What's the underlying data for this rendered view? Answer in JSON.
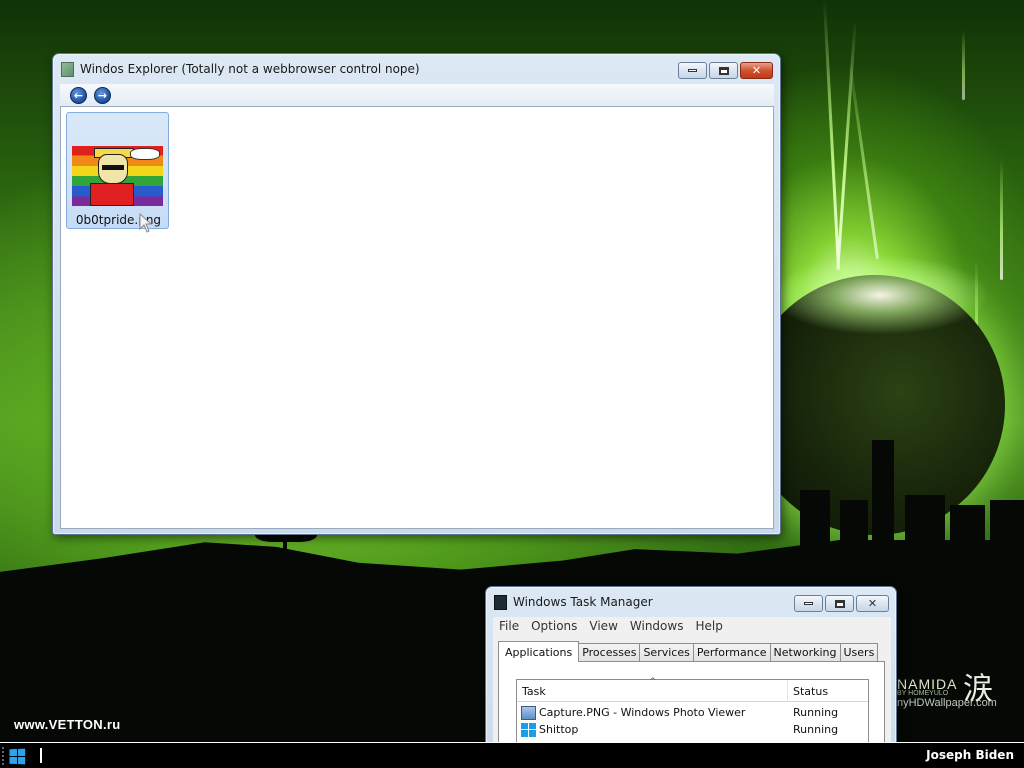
{
  "desktop": {
    "watermark_left": "www.VETTON.ru",
    "watermark_right_title": "NAMIDA",
    "watermark_right_sub": "BY HOMEYULO",
    "watermark_right_url": "nyHDWallpaper.com",
    "watermark_kanji": "涙"
  },
  "explorer": {
    "title": "Windos Explorer (Totally not a webbrowser control nope)",
    "back_icon": "back-arrow-icon",
    "forward_icon": "forward-arrow-icon",
    "back_glyph": "←",
    "forward_glyph": "→",
    "files": [
      {
        "name": "0b0tpride.png",
        "icon": "image-thumbnail"
      }
    ]
  },
  "window_buttons": {
    "minimize": "minimize",
    "maximize": "maximize",
    "close_glyph": "✕"
  },
  "taskmgr": {
    "title": "Windows Task Manager",
    "menu": [
      "File",
      "Options",
      "View",
      "Windows",
      "Help"
    ],
    "tabs": [
      "Applications",
      "Processes",
      "Services",
      "Performance",
      "Networking",
      "Users"
    ],
    "active_tab": "Applications",
    "columns": {
      "task": "Task",
      "status": "Status"
    },
    "rows": [
      {
        "task": "Capture.PNG - Windows Photo Viewer",
        "status": "Running",
        "icon": "photo-viewer-icon"
      },
      {
        "task": "Shittop",
        "status": "Running",
        "icon": "windows-logo-icon"
      }
    ]
  },
  "taskbar": {
    "user_name": "Joseph Biden",
    "start_icon": "windows-logo-icon"
  },
  "colors": {
    "titlebar": "#c9daec",
    "close_button": "#c3361a",
    "taskbar": "#000000",
    "selection": "#c6dcf6",
    "windows_blue": "#1a9ee8"
  }
}
